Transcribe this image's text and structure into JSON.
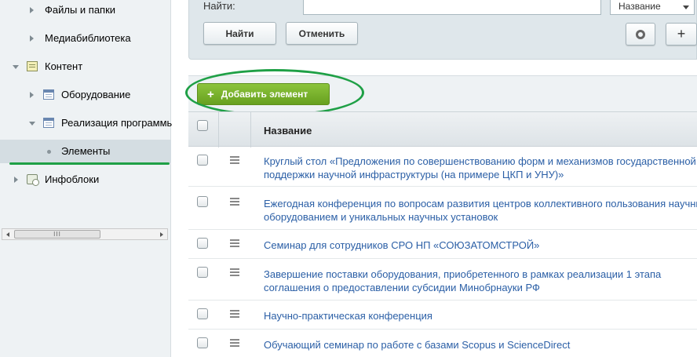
{
  "sidebar": {
    "items": [
      {
        "label": "Файлы и папки"
      },
      {
        "label": "Медиабиблиотека"
      },
      {
        "label": "Контент"
      },
      {
        "label": "Оборудование"
      },
      {
        "label": "Реализация программы"
      },
      {
        "label": "Элементы"
      },
      {
        "label": "Инфоблоки"
      }
    ],
    "scrollbar_grip": "III"
  },
  "filter": {
    "find_label": "Найти:",
    "find_value": "",
    "field_select": "Название",
    "find_button": "Найти",
    "cancel_button": "Отменить",
    "add_filter_symbol": "+"
  },
  "toolbar": {
    "add_symbol": "+",
    "add_label": "Добавить элемент"
  },
  "grid": {
    "column_title": "Название",
    "rows": [
      {
        "line1": "Круглый стол «Предложения по совершенствованию форм и механизмов государственной",
        "line2": "поддержки научной инфраструктуры (на примере ЦКП и УНУ)»"
      },
      {
        "line1": "Ежегодная конференция по вопросам развития центров коллективного пользования научны",
        "line2": "оборудованием и уникальных научных установок"
      },
      {
        "line1": "Семинар для сотрудников СРО НП «СОЮЗАТОМСТРОЙ»",
        "line2": ""
      },
      {
        "line1": "Завершение поставки оборудования, приобретенного в рамках реализации 1 этапа",
        "line2": "соглашения о предоставлении субсидии Минобрнауки РФ"
      },
      {
        "line1": "Научно-практическая конференция",
        "line2": ""
      },
      {
        "line1": "Обучающий семинар по работе с базами Scopus и ScienceDirect",
        "line2": ""
      }
    ]
  },
  "colors": {
    "link": "#2b5fa6",
    "add_button": "#7ab32e",
    "annotation": "#1fa046"
  }
}
